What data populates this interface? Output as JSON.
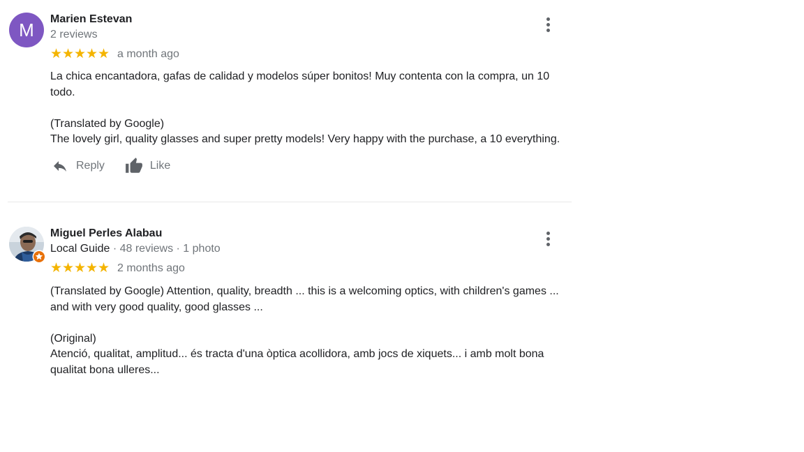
{
  "reviews": [
    {
      "author": "Marien Estevan",
      "avatar_letter": "M",
      "avatar_color": "#7e57c2",
      "meta": "2 reviews",
      "rating": 5,
      "stars": "★★★★★",
      "date": "a month ago",
      "paragraphs": [
        "La chica encantadora, gafas de calidad y modelos súper bonitos! Muy contenta con la compra, un 10 todo.",
        "(Translated by Google)",
        "The lovely girl, quality glasses and super pretty models! Very happy with the purchase, a 10 everything."
      ],
      "actions": {
        "reply_label": "Reply",
        "like_label": "Like",
        "reply_icon": "reply-icon",
        "like_icon": "thumbs-up-icon"
      },
      "more_icon": "more-vert-icon"
    },
    {
      "author": "Miguel Perles Alabau",
      "meta_guide": "Local Guide",
      "meta_rest": " · 48 reviews · 1 photo",
      "rating": 5,
      "stars": "★★★★★",
      "date": "2 months ago",
      "paragraphs": [
        "(Translated by Google) Attention, quality, breadth ... this is a welcoming optics, with children's games ... and with very good quality, good glasses ...",
        "(Original)",
        "Atenció, qualitat, amplitud... és tracta  d'una òptica acollidora, amb jocs de xiquets... i amb molt bona qualitat bona ulleres..."
      ],
      "more_icon": "more-vert-icon",
      "badge_icon": "local-guide-badge-icon"
    }
  ],
  "colors": {
    "star": "#f4b400",
    "secondary_text": "#70757a",
    "primary_text": "#202124",
    "badge": "#e8710a"
  }
}
